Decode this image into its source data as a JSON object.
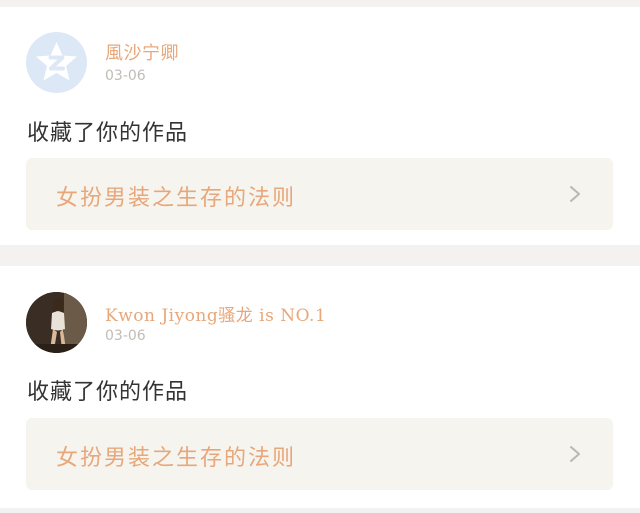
{
  "feed": {
    "items": [
      {
        "username": "風沙宁卿",
        "date": "03-06",
        "action": "收藏了你的作品",
        "work_title": "女扮男装之生存的法则",
        "avatar_icon": "default-avatar-star-icon"
      },
      {
        "username": "Kwon Jiyong骚龙 is NO.1",
        "date": "03-06",
        "action": "收藏了你的作品",
        "work_title": "女扮男装之生存的法则",
        "avatar_icon": "user-photo"
      }
    ]
  },
  "colors": {
    "accent": "#e8a77a",
    "muted": "#c0bcb6",
    "work_box_bg": "#f5f4ee",
    "page_bg": "#f3f2f0"
  }
}
